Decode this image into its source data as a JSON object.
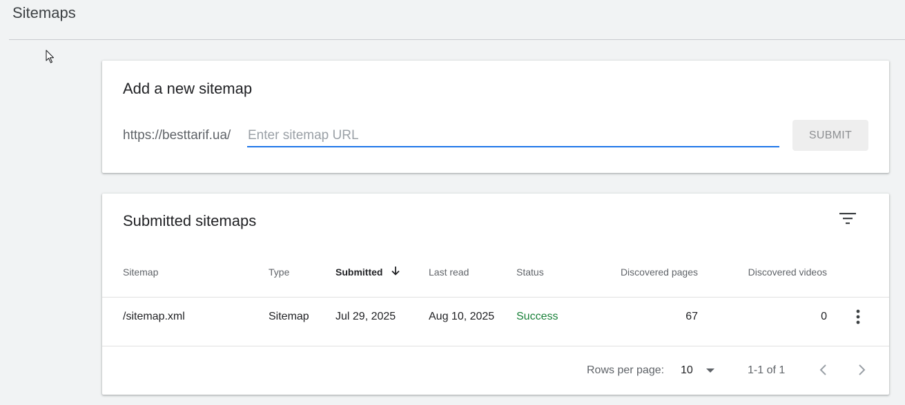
{
  "header": {
    "title": "Sitemaps"
  },
  "add_sitemap": {
    "title": "Add a new sitemap",
    "url_prefix": "https://besttarif.ua/",
    "input_value": "",
    "input_placeholder": "Enter sitemap URL",
    "submit_label": "SUBMIT"
  },
  "submitted": {
    "title": "Submitted sitemaps",
    "columns": {
      "sitemap": "Sitemap",
      "type": "Type",
      "submitted": "Submitted",
      "last_read": "Last read",
      "status": "Status",
      "discovered_pages": "Discovered pages",
      "discovered_videos": "Discovered videos"
    },
    "sort_column": "Submitted",
    "sort_direction": "descending",
    "rows": [
      {
        "sitemap": "/sitemap.xml",
        "type": "Sitemap",
        "submitted": "Jul 29, 2025",
        "last_read": "Aug 10, 2025",
        "status": "Success",
        "discovered_pages": "67",
        "discovered_videos": "0"
      }
    ],
    "pagination": {
      "rows_per_page_label": "Rows per page:",
      "rows_per_page": "10",
      "range": "1-1 of 1"
    }
  },
  "icons": {
    "filter": "filter-icon",
    "sort": "arrow-down-icon",
    "more": "more-vert-icon",
    "dropdown": "caret-down-icon",
    "prev": "chevron-left-icon",
    "next": "chevron-right-icon",
    "cursor": "mouse-pointer-icon"
  },
  "colors": {
    "background": "#f1f3f4",
    "accent": "#1a73e8",
    "success": "#188038",
    "muted_text": "#5f6368"
  }
}
